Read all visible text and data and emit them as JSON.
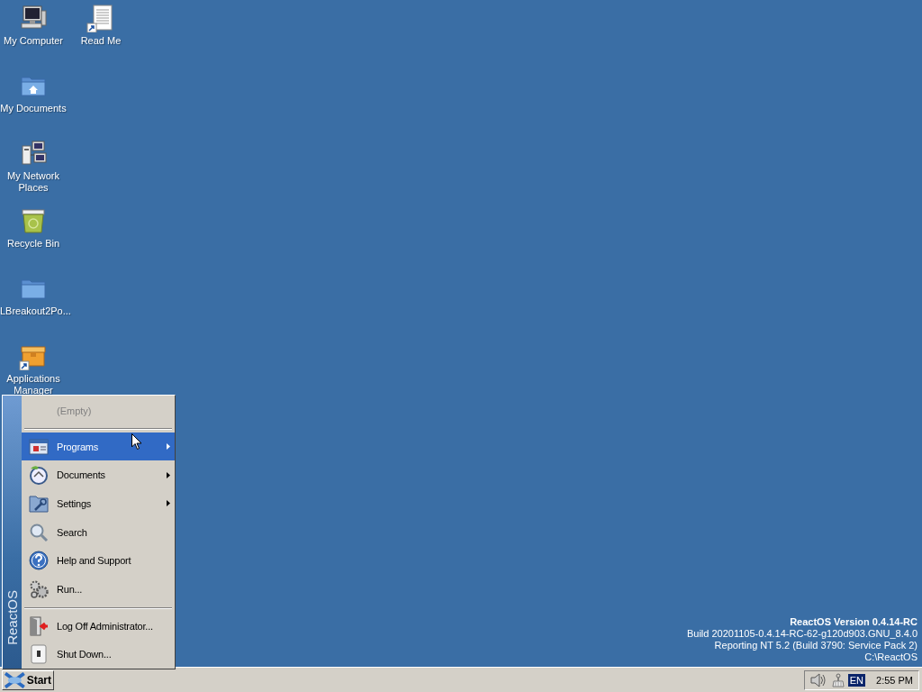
{
  "desktop_icons": [
    {
      "label": "My Computer",
      "kind": "computer"
    },
    {
      "label": "My Documents",
      "kind": "documents"
    },
    {
      "label": "My Network Places",
      "kind": "network"
    },
    {
      "label": "Recycle Bin",
      "kind": "recycle"
    },
    {
      "label": "LBreakout2Po...",
      "kind": "folder"
    },
    {
      "label": "Applications Manager",
      "kind": "package"
    },
    {
      "label": "Read Me",
      "kind": "readme"
    }
  ],
  "version_info": {
    "title": "ReactOS Version 0.4.14-RC",
    "lines": [
      "Build 20201105-0.4.14-RC-62-g120d903.GNU_8.4.0",
      "Reporting NT 5.2 (Build 3790: Service Pack 2)",
      "C:\\ReactOS"
    ]
  },
  "start_menu": {
    "banner": "ReactOS",
    "items": [
      {
        "kind": "empty",
        "label": "(Empty)"
      },
      {
        "kind": "separator"
      },
      {
        "kind": "programs",
        "label": "Programs",
        "submenu": true,
        "selected": true
      },
      {
        "kind": "documents",
        "label": "Documents",
        "submenu": true,
        "selected": false
      },
      {
        "kind": "settings",
        "label": "Settings",
        "submenu": true,
        "selected": false
      },
      {
        "kind": "search",
        "label": "Search",
        "submenu": false,
        "selected": false
      },
      {
        "kind": "help",
        "label": "Help and Support",
        "submenu": false,
        "selected": false
      },
      {
        "kind": "run",
        "label": "Run...",
        "submenu": false,
        "selected": false
      },
      {
        "kind": "separator"
      },
      {
        "kind": "logoff",
        "label": "Log Off Administrator...",
        "submenu": false,
        "selected": false
      },
      {
        "kind": "shutdown",
        "label": "Shut Down...",
        "submenu": false,
        "selected": false
      }
    ]
  },
  "taskbar": {
    "start_label": "Start",
    "language": "EN",
    "clock": "2:55 PM"
  }
}
